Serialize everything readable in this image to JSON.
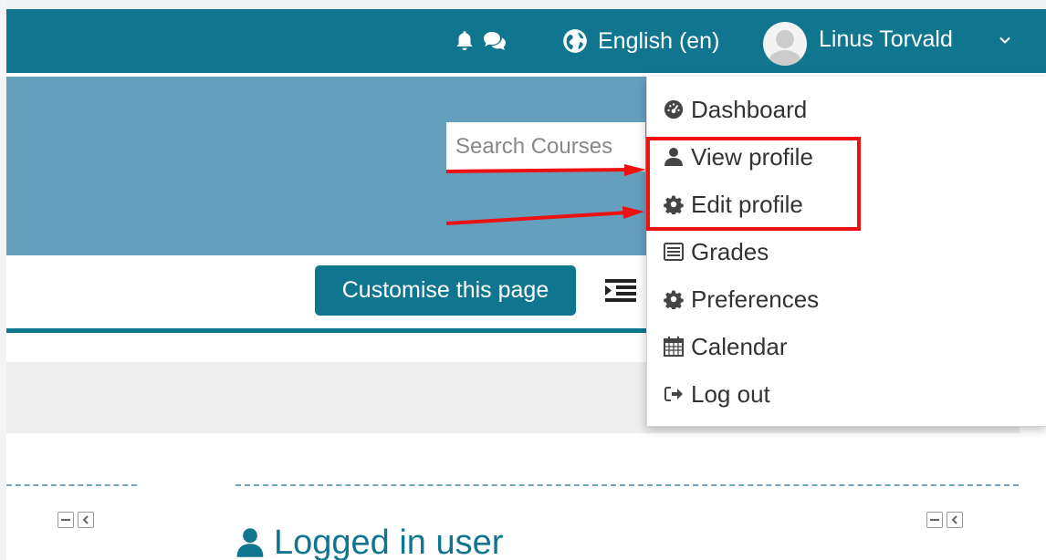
{
  "navbar": {
    "notification_icon": "bell-icon",
    "messages_icon": "chat-icon",
    "language_icon": "globe-icon",
    "language_label": "English (en)",
    "user_name": "Linus Torvald",
    "caret_icon": "chevron-down-icon"
  },
  "banner": {
    "search_placeholder": "Search Courses"
  },
  "page_header": {
    "customise_label": "Customise this page",
    "block_toggle_icon": "indent-icon"
  },
  "user_menu": {
    "items": [
      {
        "label": "Dashboard",
        "icon": "dashboard-icon"
      },
      {
        "label": "View profile",
        "icon": "user-icon"
      },
      {
        "label": "Edit profile",
        "icon": "gear-icon"
      },
      {
        "label": "Grades",
        "icon": "grades-icon"
      },
      {
        "label": "Preferences",
        "icon": "gear-icon"
      },
      {
        "label": "Calendar",
        "icon": "calendar-icon"
      },
      {
        "label": "Log out",
        "icon": "logout-icon"
      }
    ]
  },
  "annotation": {
    "highlight_color": "#ee1111",
    "arrow_color": "#ee1111"
  },
  "block": {
    "title": "Logged in user",
    "title_icon": "user-icon",
    "collapse_icon": "minus-icon",
    "dock_icon": "dock-left-icon"
  },
  "colors": {
    "navbar": "#10768f",
    "banner": "#649fbe",
    "accent": "#10768f"
  }
}
